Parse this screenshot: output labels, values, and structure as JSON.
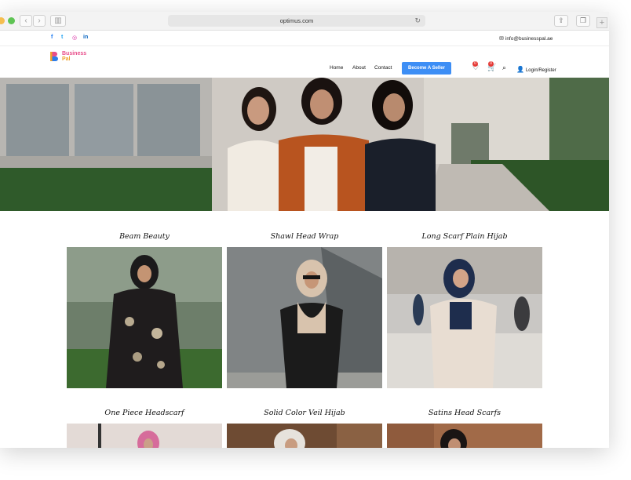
{
  "browser": {
    "url": "optimus.com",
    "back_icon": "chevron-left-icon",
    "forward_icon": "chevron-right-icon",
    "sidebar_icon": "sidebar-icon",
    "reload_icon": "reload-icon",
    "share_icon": "share-icon",
    "tabs_icon": "tabs-icon",
    "new_tab_icon": "plus-icon"
  },
  "topbar": {
    "social": [
      {
        "name": "facebook-icon",
        "glyph": "f",
        "color": "#1877f2"
      },
      {
        "name": "twitter-icon",
        "glyph": "t",
        "color": "#1da1f2"
      },
      {
        "name": "instagram-icon",
        "glyph": "◎",
        "color": "#d6249f"
      },
      {
        "name": "linkedin-icon",
        "glyph": "in",
        "color": "#0a66c2"
      }
    ],
    "email": "info@businesspal.ae"
  },
  "header": {
    "logo_line1": "Business",
    "logo_line2": "Pal",
    "nav": [
      "Home",
      "About",
      "Contact"
    ],
    "become_seller": "Become A Seller",
    "wishlist_count": "0",
    "cart_count": "0",
    "login": "Login/Register",
    "accent": "#3d8ef5",
    "badge_color": "#e53935"
  },
  "products": [
    {
      "title": "Beam Beauty"
    },
    {
      "title": "Shawl Head Wrap"
    },
    {
      "title": "Long Scarf Plain Hijab"
    },
    {
      "title": "One Piece Headscarf"
    },
    {
      "title": "Solid Color Veil Hijab"
    },
    {
      "title": "Satins Head Scarfs"
    }
  ]
}
